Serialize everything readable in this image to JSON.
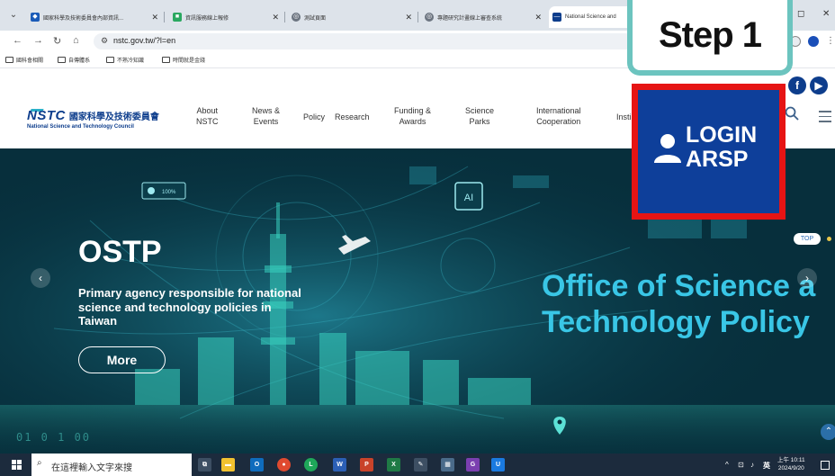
{
  "browser": {
    "tabs": [
      {
        "label": "國家科學及技術委員會內部資訊...",
        "active": false
      },
      {
        "label": "資訊服務線上報修",
        "active": false
      },
      {
        "label": "測試頁面",
        "active": false
      },
      {
        "label": "專題研究計畫線上審查系統",
        "active": false
      },
      {
        "label": "National Science and",
        "active": true
      }
    ],
    "url": "nstc.gov.tw/?l=en",
    "bookmarks": [
      "國科會相關",
      "自傳體系",
      "不熟冷知識",
      "時間就是金錢"
    ]
  },
  "site": {
    "logo_mark": "NSTC",
    "logo_zh": "國家科學及技術委員會",
    "logo_en": "National Science and Technology Council",
    "nav": [
      {
        "line1": "About",
        "line2": "NSTC"
      },
      {
        "line1": "News &",
        "line2": "Events"
      },
      {
        "line1": "Policy",
        "line2": ""
      },
      {
        "line1": "Research",
        "line2": ""
      },
      {
        "line1": "Funding &",
        "line2": "Awards"
      },
      {
        "line1": "Science",
        "line2": "Parks"
      },
      {
        "line1": "International",
        "line2": "Cooperation"
      },
      {
        "line1": "Insti",
        "line2": ""
      }
    ]
  },
  "hero": {
    "title": "OSTP",
    "description": "Primary agency responsible for national science and technology policies in Taiwan",
    "more_label": "More",
    "big_line1": "Office of Science a",
    "big_line2": "Technology Policy",
    "top_label": "TOP",
    "bottom_code": "01 0 1 00",
    "chip_label": "AI",
    "percent_label": "100%"
  },
  "overlay": {
    "step_label": "Step 1",
    "login_line1": "LOGIN",
    "login_line2": "ARSP"
  },
  "taskbar": {
    "search_placeholder": "在這裡輸入文字來搜",
    "tray_text": "英",
    "time": "上午 10:11",
    "date": "2024/9/20"
  },
  "colors": {
    "brand_navy": "#0d3d8c",
    "hero_bg": "#072f3c",
    "accent_cyan": "#39c6e6",
    "highlight_red": "#e61414",
    "step_border": "#6cc4bf"
  }
}
